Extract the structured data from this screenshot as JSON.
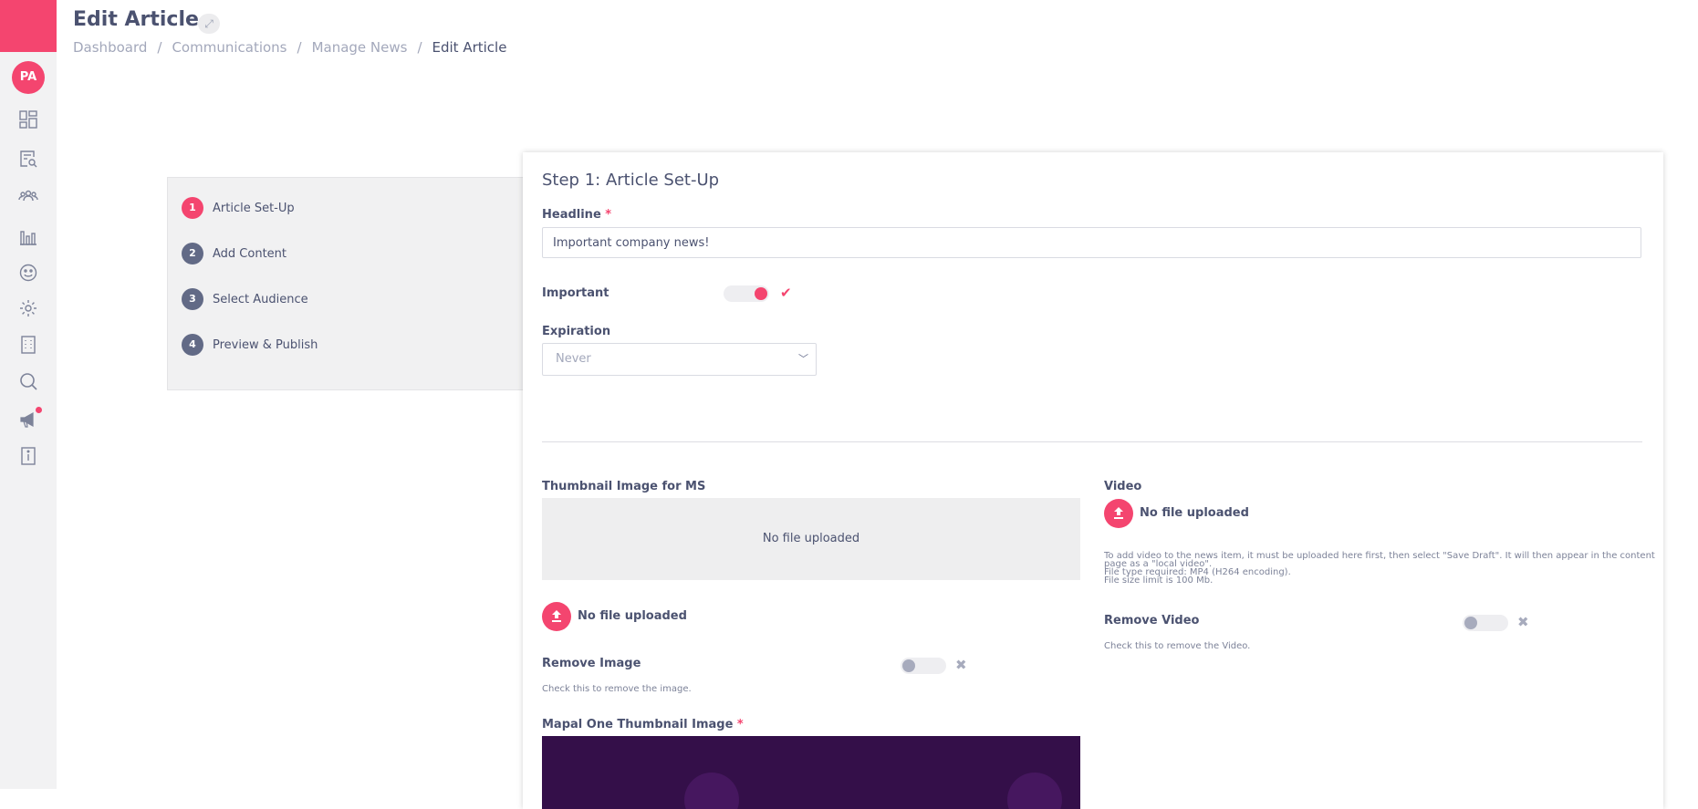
{
  "sidebar": {
    "avatar_initials": "PA",
    "brand_color": "#f4456f",
    "icons": [
      "dashboard-icon",
      "search-document-icon",
      "users-icon",
      "bar-chart-icon",
      "smiley-icon",
      "gear-icon",
      "building-icon",
      "search-icon",
      "megaphone-icon",
      "info-card-icon"
    ]
  },
  "header": {
    "title": "Edit Article",
    "breadcrumb": [
      "Dashboard",
      "Communications",
      "Manage News",
      "Edit Article"
    ],
    "separator": "/"
  },
  "steps": [
    {
      "num": "1",
      "label": "Article Set-Up"
    },
    {
      "num": "2",
      "label": "Add Content"
    },
    {
      "num": "3",
      "label": "Select Audience"
    },
    {
      "num": "4",
      "label": "Preview & Publish"
    }
  ],
  "form": {
    "title": "Step 1: Article Set-Up",
    "headline_label": "Headline",
    "required_mark": "*",
    "headline_value": "Important company news!",
    "important_label": "Important",
    "expiration_label": "Expiration",
    "expiration_value": "Never",
    "thumbnail_label": "Thumbnail Image for MS",
    "no_file": "No file uploaded",
    "remove_image_label": "Remove Image",
    "remove_image_hint": "Check this to remove the image.",
    "mapal_thumb_label": "Mapal One Thumbnail Image",
    "video_label": "Video",
    "video_hint_1": "To add video to the news item, it must be uploaded here first, then select \"Save Draft\". It will then appear in the content",
    "video_hint_2": "page as a \"local video\".",
    "video_hint_3": "File type required: MP4 (H264 encoding).",
    "video_hint_4": "File size limit is 100 Mb.",
    "remove_video_label": "Remove Video",
    "remove_video_hint": "Check this to remove the Video."
  }
}
